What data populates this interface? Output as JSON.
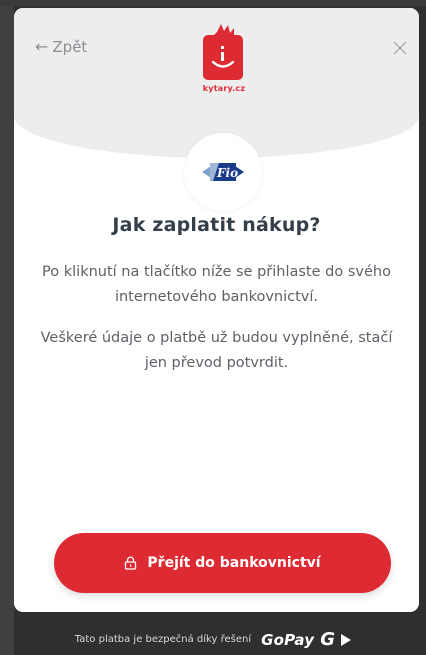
{
  "header": {
    "back_label": "Zpět",
    "logo_text": "kytary.cz"
  },
  "content": {
    "title": "Jak zaplatit nákup?",
    "paragraph1": "Po kliknutí na tlačítko níže se přihlaste do svého internetového bankovnictví.",
    "paragraph2": "Veškeré údaje o platbě už budou vyplněné, stačí jen převod potvrdit.",
    "bank_logo_text": "Fio"
  },
  "actions": {
    "primary_label": "Přejít do bankovnictví"
  },
  "footer": {
    "text": "Tato platba je bezpečná díky řešení",
    "brand": "GoPay",
    "brand_letter": "G"
  },
  "icons": {
    "back": "arrow-left-icon",
    "close": "close-icon",
    "lock": "lock-icon",
    "gopay_arrow": "play-icon"
  },
  "colors": {
    "accent": "#dd2a33",
    "header_bg": "#ededee",
    "page_bg": "#2f2f31",
    "title": "#353f4a",
    "text": "#5d6168",
    "muted": "#8c8e94",
    "bank_blue": "#1a3a8a"
  }
}
